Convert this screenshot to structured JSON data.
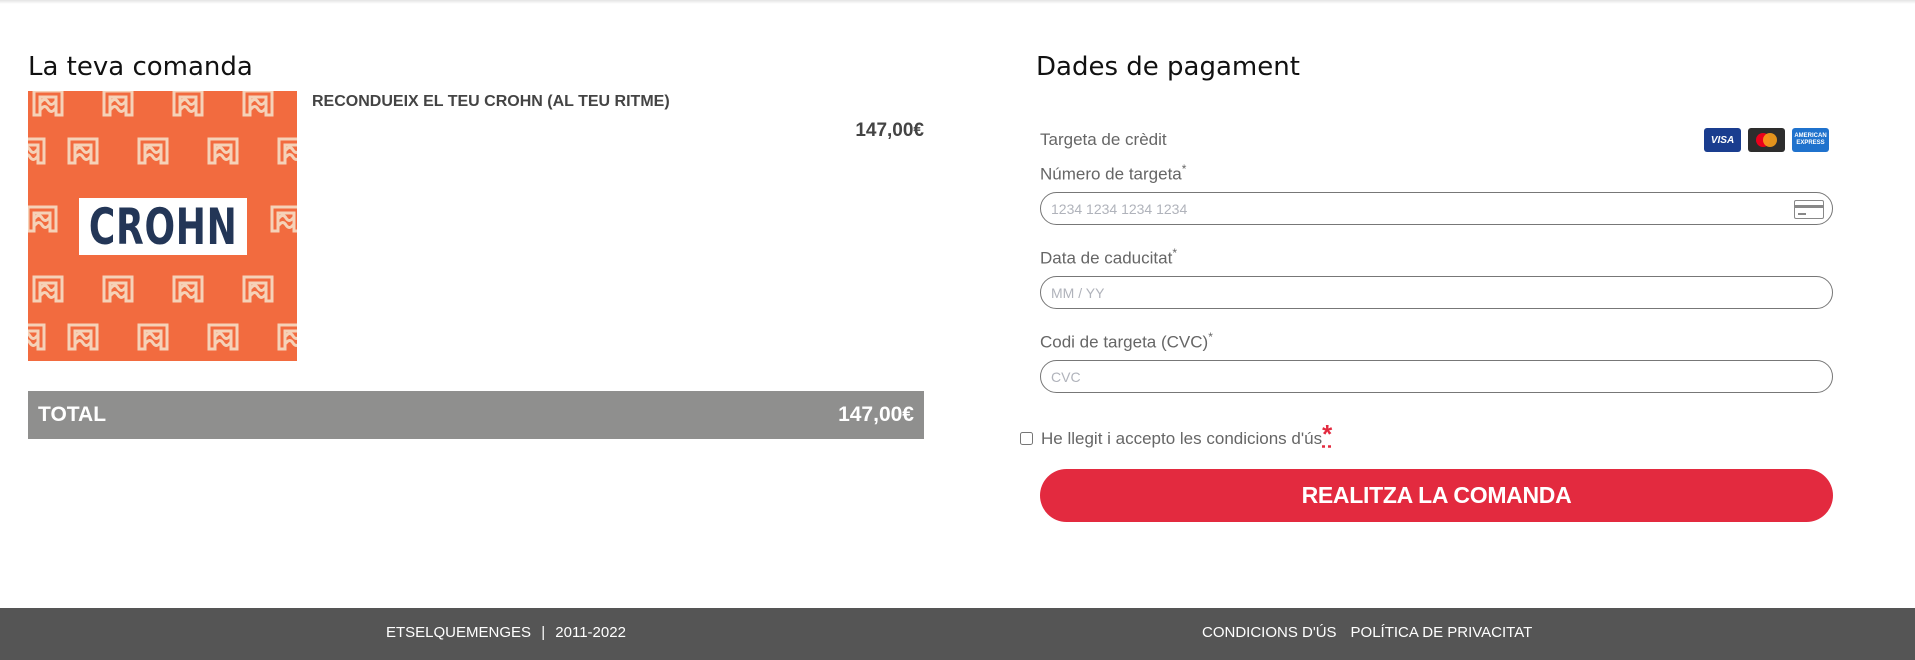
{
  "order": {
    "title": "La teva comanda",
    "item": {
      "image_text": "CROHN",
      "name": "RECONDUEIX EL TEU CROHN (AL TEU RITME)",
      "price": "147,00€"
    },
    "total_label": "TOTAL",
    "total_value": "147,00€"
  },
  "payment": {
    "title": "Dades de pagament",
    "method_label": "Targeta de crèdit",
    "card_brands": {
      "visa": "VISA",
      "mastercard_icon": "mastercard-icon",
      "amex": "AMERICAN EXPRESS"
    },
    "card_number": {
      "label": "Número de targeta",
      "placeholder": "1234 1234 1234 1234",
      "value": ""
    },
    "expiry": {
      "label": "Data de caducitat",
      "placeholder": "MM / YY",
      "value": ""
    },
    "cvc": {
      "label": "Codi de targeta (CVC)",
      "placeholder": "CVC",
      "value": ""
    },
    "required_mark": "*",
    "terms_label": "He llegit i accepto les condicions d'ús",
    "terms_checked": false,
    "submit_label": "REALITZA LA COMANDA"
  },
  "footer": {
    "brand": "ETSELQUEMENGES",
    "separator": "|",
    "years": "2011-2022",
    "links": [
      "CONDICIONS D'ÚS",
      "POLÍTICA DE PRIVACITAT"
    ]
  },
  "colors": {
    "accent": "#e32a3f",
    "product_bg": "#f26b3f",
    "total_bar": "#8f8f8e",
    "footer_bg": "#555555"
  }
}
